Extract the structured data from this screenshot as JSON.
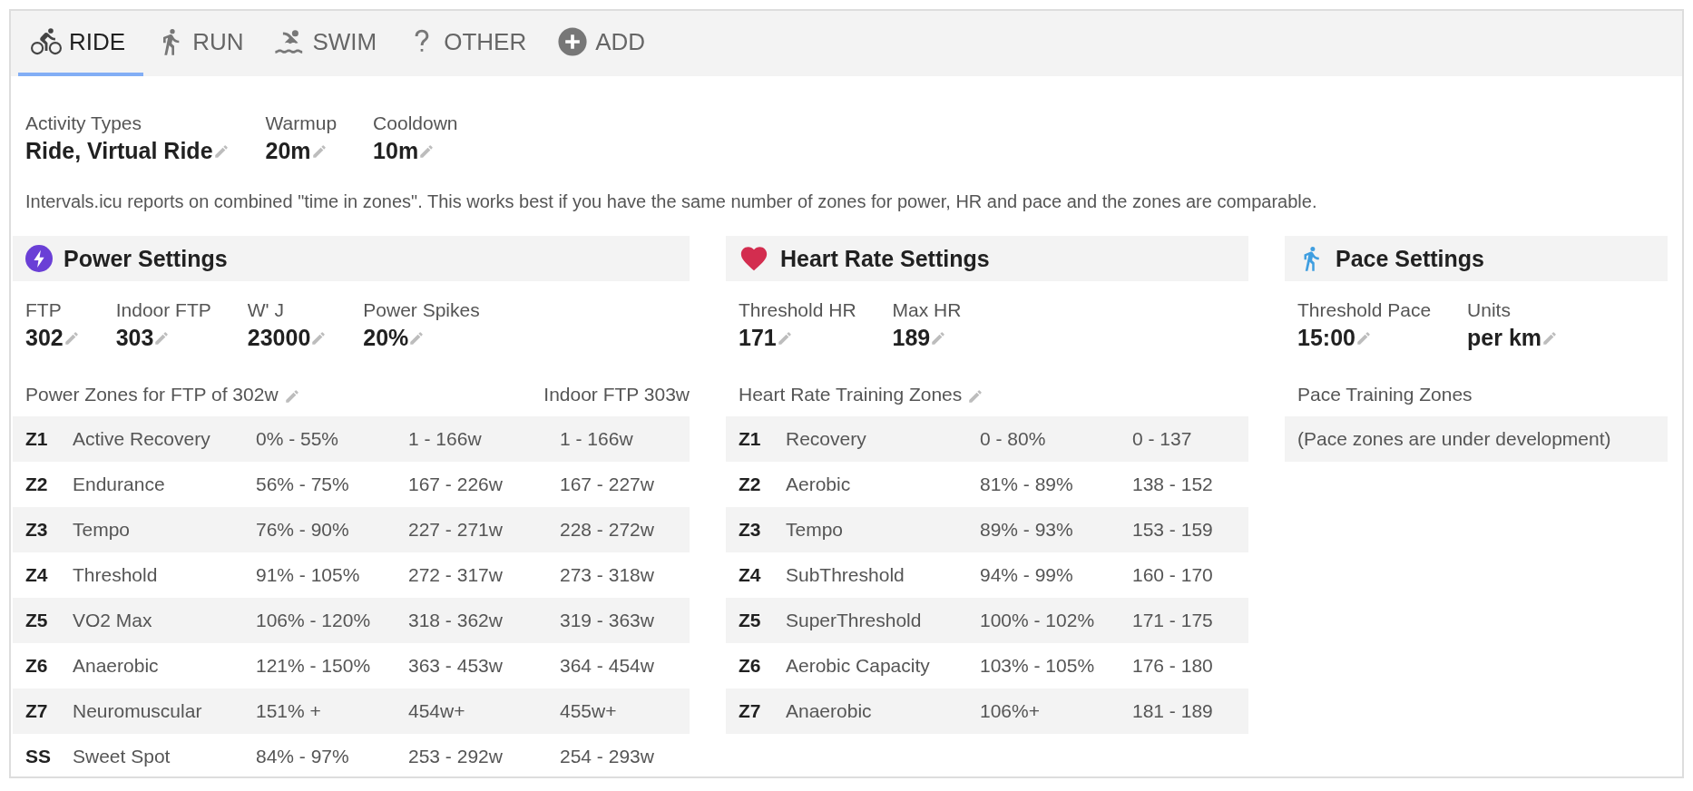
{
  "tabs": [
    {
      "label": "RIDE",
      "kind": "bike",
      "selected": true
    },
    {
      "label": "RUN",
      "kind": "run",
      "selected": false
    },
    {
      "label": "SWIM",
      "kind": "swim",
      "selected": false
    },
    {
      "label": "OTHER",
      "kind": "question",
      "selected": false
    },
    {
      "label": "ADD",
      "kind": "add",
      "selected": false
    }
  ],
  "general": [
    {
      "label": "Activity Types",
      "value": "Ride, Virtual Ride"
    },
    {
      "label": "Warmup",
      "value": "20m"
    },
    {
      "label": "Cooldown",
      "value": "10m"
    }
  ],
  "note": "Intervals.icu reports on combined \"time in zones\". This works best if you have the same number of zones for power, HR and pace and the zones are comparable.",
  "sections": [
    {
      "kind": "power",
      "title": "Power Settings",
      "fields": [
        {
          "label": "FTP",
          "value": "302"
        },
        {
          "label": "Indoor FTP",
          "value": "303"
        },
        {
          "label": "W' J",
          "value": "23000"
        },
        {
          "label": "Power Spikes",
          "value": "20%"
        }
      ],
      "zones_title": "Power Zones for FTP of 302w",
      "zones_editable": true,
      "zones_aside": "Indoor FTP 303w",
      "zones": [
        [
          "Z1",
          "Active Recovery",
          "0% - 55%",
          "1 - 166w",
          "1 - 166w"
        ],
        [
          "Z2",
          "Endurance",
          "56% - 75%",
          "167 - 226w",
          "167 - 227w"
        ],
        [
          "Z3",
          "Tempo",
          "76% - 90%",
          "227 - 271w",
          "228 - 272w"
        ],
        [
          "Z4",
          "Threshold",
          "91% - 105%",
          "272 - 317w",
          "273 - 318w"
        ],
        [
          "Z5",
          "VO2 Max",
          "106% - 120%",
          "318 - 362w",
          "319 - 363w"
        ],
        [
          "Z6",
          "Anaerobic",
          "121% - 150%",
          "363 - 453w",
          "364 - 454w"
        ],
        [
          "Z7",
          "Neuromuscular",
          "151% +",
          "454w+",
          "455w+"
        ],
        [
          "SS",
          "Sweet Spot",
          "84% - 97%",
          "253 - 292w",
          "254 - 293w"
        ]
      ]
    },
    {
      "kind": "heart",
      "title": "Heart Rate Settings",
      "fields": [
        {
          "label": "Threshold HR",
          "value": "171"
        },
        {
          "label": "Max HR",
          "value": "189"
        }
      ],
      "zones_title": "Heart Rate Training Zones",
      "zones_editable": true,
      "zones": [
        [
          "Z1",
          "Recovery",
          "0 - 80%",
          "0 - 137"
        ],
        [
          "Z2",
          "Aerobic",
          "81% - 89%",
          "138 - 152"
        ],
        [
          "Z3",
          "Tempo",
          "89% - 93%",
          "153 - 159"
        ],
        [
          "Z4",
          "SubThreshold",
          "94% - 99%",
          "160 - 170"
        ],
        [
          "Z5",
          "SuperThreshold",
          "100% - 102%",
          "171 - 175"
        ],
        [
          "Z6",
          "Aerobic Capacity",
          "103% - 105%",
          "176 - 180"
        ],
        [
          "Z7",
          "Anaerobic",
          "106%+",
          "181 - 189"
        ]
      ]
    },
    {
      "kind": "pace",
      "title": "Pace Settings",
      "fields": [
        {
          "label": "Threshold Pace",
          "value": "15:00"
        },
        {
          "label": "Units",
          "value": "per km"
        }
      ],
      "zones_title": "Pace Training Zones",
      "zones_editable": false,
      "zones_message": "(Pace zones are under development)"
    }
  ]
}
